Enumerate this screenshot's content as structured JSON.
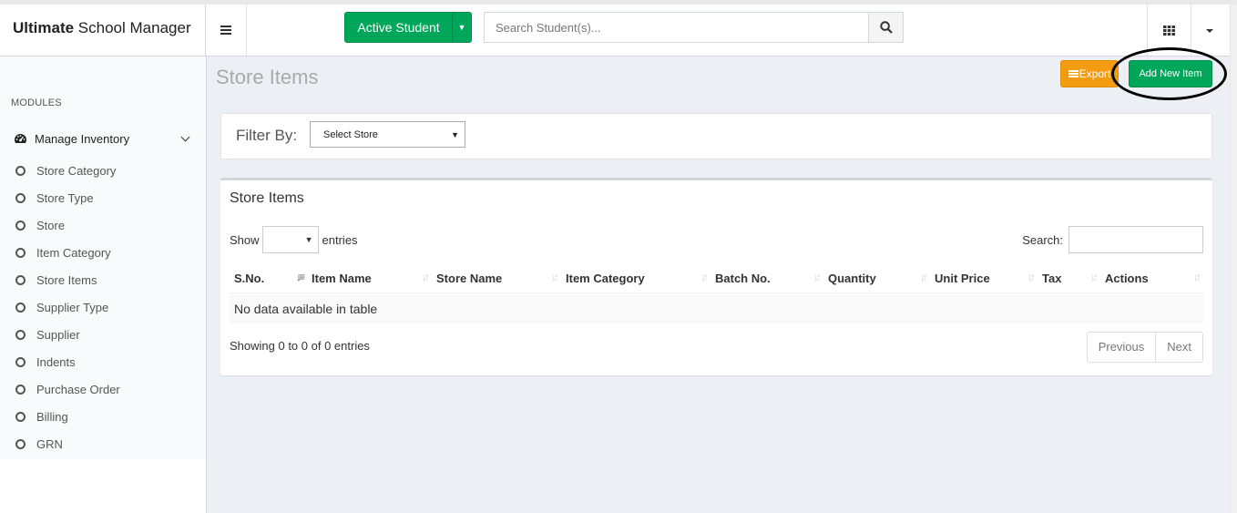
{
  "header": {
    "app_bold": "Ultimate",
    "app_rest": " School Manager",
    "active_student_label": "Active Student",
    "search_placeholder": "Search Student(s)..."
  },
  "sidebar": {
    "section_label": "MODULES",
    "group_label": "Manage Inventory",
    "items": [
      {
        "label": "Store Category"
      },
      {
        "label": "Store Type"
      },
      {
        "label": "Store"
      },
      {
        "label": "Item Category"
      },
      {
        "label": "Store Items"
      },
      {
        "label": "Supplier Type"
      },
      {
        "label": "Supplier"
      },
      {
        "label": "Indents"
      },
      {
        "label": "Purchase Order"
      },
      {
        "label": "Billing"
      },
      {
        "label": "GRN"
      }
    ]
  },
  "page": {
    "title": "Store Items",
    "export_label": "Export",
    "add_label": "Add New Item"
  },
  "filter": {
    "label": "Filter By:",
    "store_select": "Select Store"
  },
  "table": {
    "box_title": "Store Items",
    "show_label": "Show",
    "entries_label": "entries",
    "search_label": "Search:",
    "columns": [
      {
        "label": "S.No."
      },
      {
        "label": "Item Name"
      },
      {
        "label": "Store Name"
      },
      {
        "label": "Item Category"
      },
      {
        "label": "Batch No."
      },
      {
        "label": "Quantity"
      },
      {
        "label": "Unit Price"
      },
      {
        "label": "Tax"
      },
      {
        "label": "Actions"
      }
    ],
    "empty_text": "No data available in table",
    "info": "Showing 0 to 0 of 0 entries",
    "prev_label": "Previous",
    "next_label": "Next"
  },
  "colors": {
    "success": "#00a65a",
    "warning": "#f39c12"
  }
}
